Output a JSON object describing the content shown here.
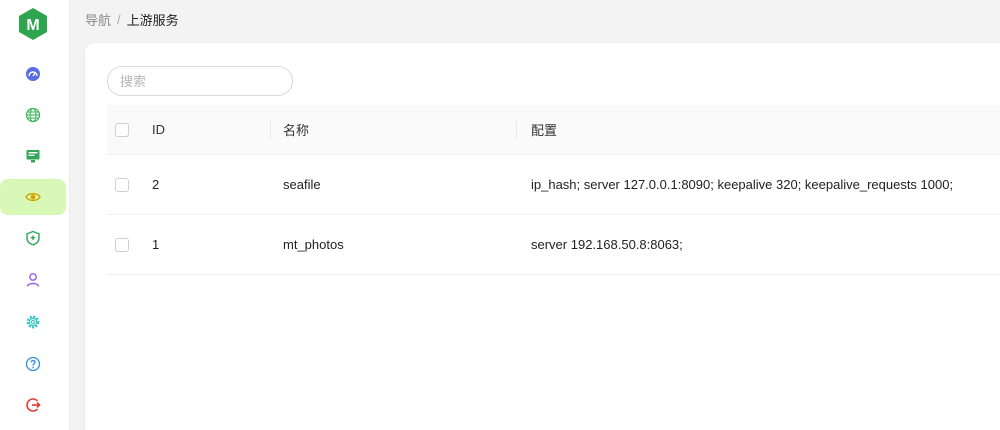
{
  "app": {
    "logo_letter": "M",
    "brand_color": "#2ea44f"
  },
  "breadcrumb": {
    "root": "导航",
    "separator": "/",
    "current": "上游服务"
  },
  "sidebar": {
    "items": [
      {
        "icon": "dashboard-icon",
        "color": "#5b6ee1",
        "active": false
      },
      {
        "icon": "globe-icon",
        "color": "#3cb55e",
        "active": false
      },
      {
        "icon": "monitor-icon",
        "color": "#2fa85a",
        "active": false
      },
      {
        "icon": "eye-icon",
        "color": "#e0b400",
        "active": true
      },
      {
        "icon": "shield-icon",
        "color": "#2fa85a",
        "active": false
      },
      {
        "icon": "user-icon",
        "color": "#9b5de5",
        "active": false
      },
      {
        "icon": "gear-icon",
        "color": "#3cc6c6",
        "active": false
      },
      {
        "icon": "help-icon",
        "color": "#2f8fe0",
        "active": false
      },
      {
        "icon": "logout-icon",
        "color": "#e53935",
        "active": false
      }
    ]
  },
  "search": {
    "placeholder": "搜索",
    "value": ""
  },
  "table": {
    "columns": [
      "ID",
      "名称",
      "配置"
    ],
    "rows": [
      {
        "id": "2",
        "name": "seafile",
        "config": "ip_hash; server 127.0.0.1:8090; keepalive 320; keepalive_requests 1000;"
      },
      {
        "id": "1",
        "name": "mt_photos",
        "config": "server 192.168.50.8:8063;"
      }
    ]
  }
}
